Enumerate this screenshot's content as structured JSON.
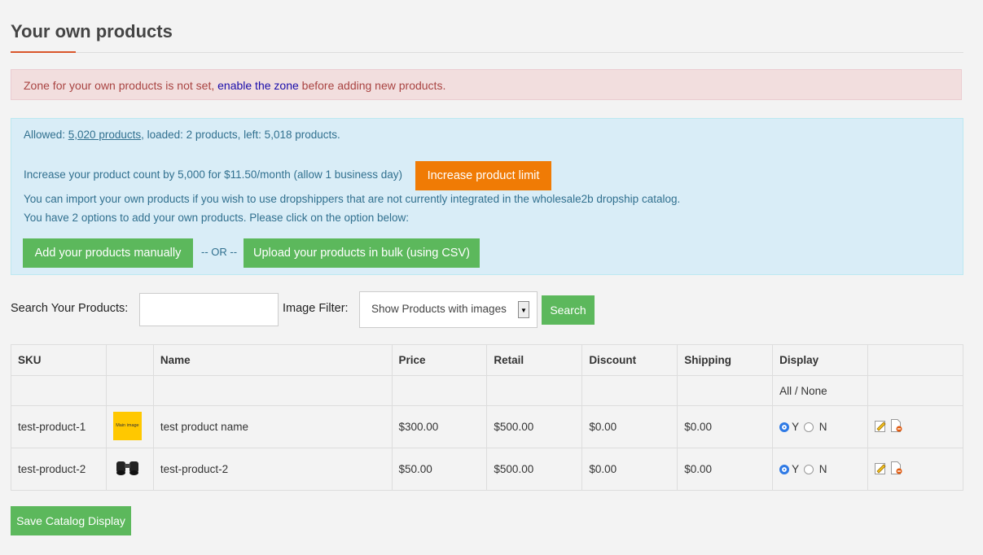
{
  "page": {
    "title": "Your own products"
  },
  "alert": {
    "prefix": "Zone for your own products is not set, ",
    "link": "enable the zone",
    "suffix": " before adding new products."
  },
  "info": {
    "allowed_prefix": "Allowed: ",
    "allowed_link": "5,020 products",
    "allowed_suffix": ", loaded: 2 products, left: 5,018 products.",
    "increase_text": "Increase your product count by 5,000 for $11.50/month (allow 1 business day)",
    "increase_button": "Increase product limit",
    "import_text": "You can import your own products if you wish to use dropshippers that are not currently integrated in the wholesale2b dropship catalog.",
    "options_text": "You have 2 options to add your own products. Please click on the option below:",
    "manual_button": "Add your products manually",
    "or_text": "-- OR --",
    "bulk_button": "Upload your products in bulk (using CSV)"
  },
  "search": {
    "label": "Search Your Products:",
    "input_value": "",
    "filter_label": "Image Filter:",
    "filter_selected": "Show Products with images",
    "button": "Search"
  },
  "table": {
    "headers": [
      "SKU",
      "",
      "Name",
      "Price",
      "Retail",
      "Discount",
      "Shipping",
      "Display",
      ""
    ],
    "display_toggle": "All / None",
    "radio_yes": "Y",
    "radio_no": "N",
    "rows": [
      {
        "sku": "test-product-1",
        "image": "Main image",
        "name": "test product name",
        "price": "$300.00",
        "retail": "$500.00",
        "discount": "$0.00",
        "shipping": "$0.00",
        "display": "Y"
      },
      {
        "sku": "test-product-2",
        "image": "binoculars",
        "name": "test-product-2",
        "price": "$50.00",
        "retail": "$500.00",
        "discount": "$0.00",
        "shipping": "$0.00",
        "display": "Y"
      }
    ]
  },
  "footer": {
    "save_button": "Save Catalog Display"
  },
  "colors": {
    "accent_orange": "#f07b05",
    "green": "#5cb85c",
    "danger_bg": "#f2dede",
    "info_bg": "#d9edf7"
  }
}
